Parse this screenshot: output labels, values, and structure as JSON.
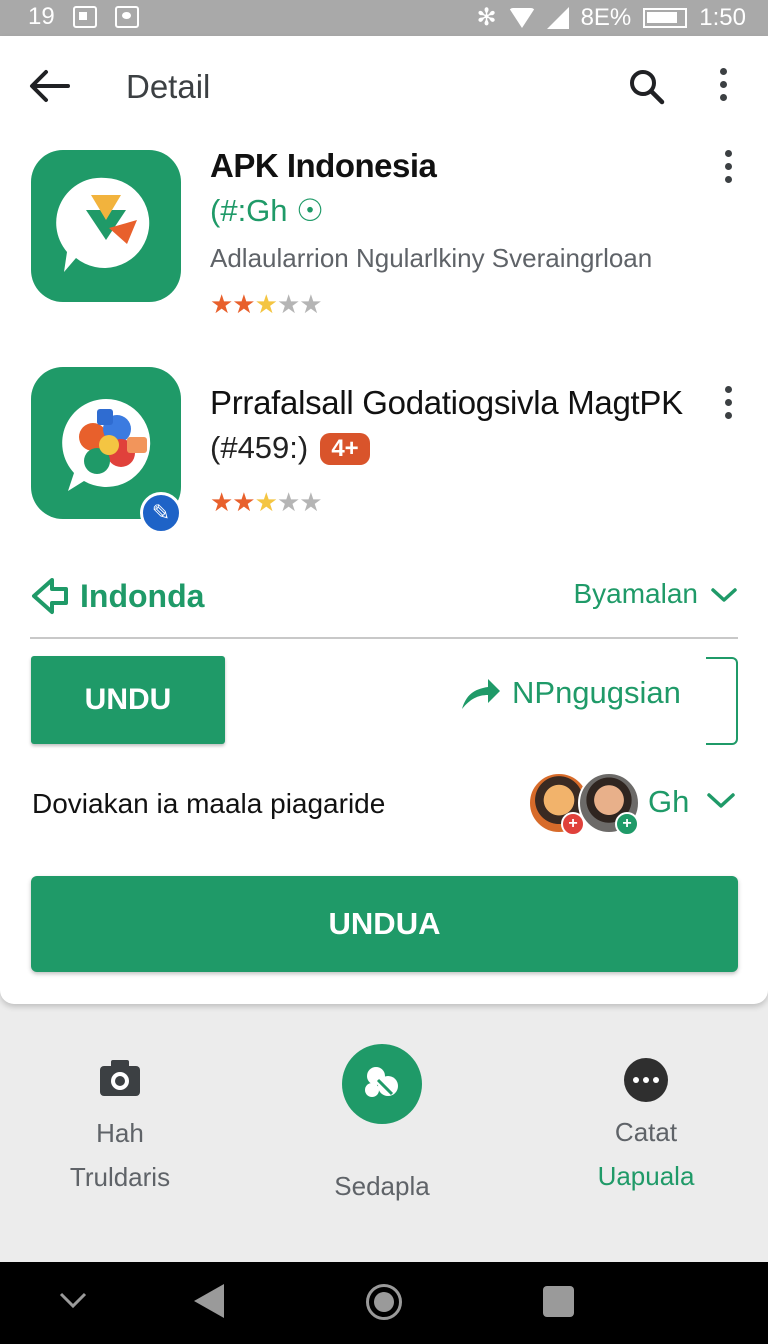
{
  "status_bar": {
    "time_left": "19",
    "battery": "8E%",
    "clock": "1:50"
  },
  "header": {
    "title": "Detail"
  },
  "apps": [
    {
      "name": "APK Indonesia",
      "subtitle": "(#:Gh",
      "subtitle_symbol": "☉",
      "description": "Adlaularrion Ngularlkiny Sveraingrloan",
      "rating": 2.5,
      "icon": "chat-bubble-app-icon"
    },
    {
      "name": "Prrafalsall Godatiogsivla MagtPK",
      "subtitle": "(#459:)",
      "age_badge": "4+",
      "rating": 2.5,
      "icon": "chat-bubble-puzzle-app-icon",
      "badge_icon": "tool-icon"
    }
  ],
  "section": {
    "label": "Indonda",
    "right_label": "Byamalan"
  },
  "actions": {
    "primary_small": "UNDU",
    "share_label": "NPngugsian",
    "review_text": "Doviakan ia maala piagaride",
    "reviewers_label": "Gh",
    "primary_large": "UNDUA"
  },
  "bottom_nav": {
    "left": {
      "label1": "Hah",
      "label2": "Truldaris",
      "icon": "camera-icon"
    },
    "middle": {
      "label": "Sedapla",
      "icon": "share-fab-icon"
    },
    "right": {
      "label1": "Catat",
      "label2": "Uapuala",
      "icon": "chat-more-icon"
    }
  },
  "colors": {
    "accent": "#1f9a68",
    "star_on": "#e8602c",
    "star_half": "#f4c542",
    "age_badge": "#d9542b"
  }
}
